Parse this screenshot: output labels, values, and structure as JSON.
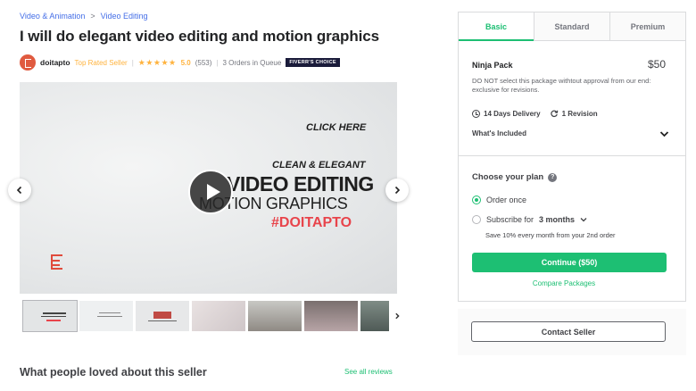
{
  "breadcrumb": {
    "items": [
      "Video & Animation",
      "Video Editing"
    ],
    "separator": ">"
  },
  "gig": {
    "title": "I will do elegant video editing and motion graphics"
  },
  "seller": {
    "name": "doitapto",
    "level": "Top Rated Seller",
    "separator": "|",
    "stars": "★★★★★",
    "rating": "5.0",
    "review_count": "(553)",
    "orders_in_queue": "3 Orders in Queue",
    "badge": "FIVERR'S CHOICE"
  },
  "gallery": {
    "click_here": "CLICK HERE",
    "tagline": "CLEAN & ELEGANT",
    "headline": "VIDEO EDITING",
    "subheadline": "MOTION GRAPHICS",
    "hashtag": "#DOITAPTO",
    "prev_icon": "chevron-left-icon",
    "next_icon": "chevron-right-icon",
    "thumbnail_count": 7
  },
  "reviews": {
    "heading": "What people loved about this seller",
    "see_all": "See all reviews"
  },
  "packages": {
    "tabs": [
      {
        "label": "Basic",
        "active": true
      },
      {
        "label": "Standard",
        "active": false
      },
      {
        "label": "Premium",
        "active": false
      }
    ],
    "selected": {
      "name": "Ninja Pack",
      "price": "$50",
      "description": "DO NOT select this package withtout approval from our end: exclusive for revisions.",
      "delivery": "14 Days Delivery",
      "revisions": "1 Revision",
      "included_label": "What's Included"
    },
    "plan": {
      "heading": "Choose your plan",
      "option_once": "Order once",
      "option_subscribe_prefix": "Subscribe for",
      "option_subscribe_period": "3 months",
      "subscribe_note": "Save 10% every month from your 2nd order",
      "selected_option": "Order once"
    },
    "continue_label": "Continue ($50)",
    "compare_label": "Compare Packages",
    "contact_label": "Contact Seller"
  },
  "colors": {
    "brand_green": "#1dbf73",
    "link_blue": "#446ee7",
    "star_gold": "#ffb33e",
    "hashtag_red": "#e8444b"
  }
}
